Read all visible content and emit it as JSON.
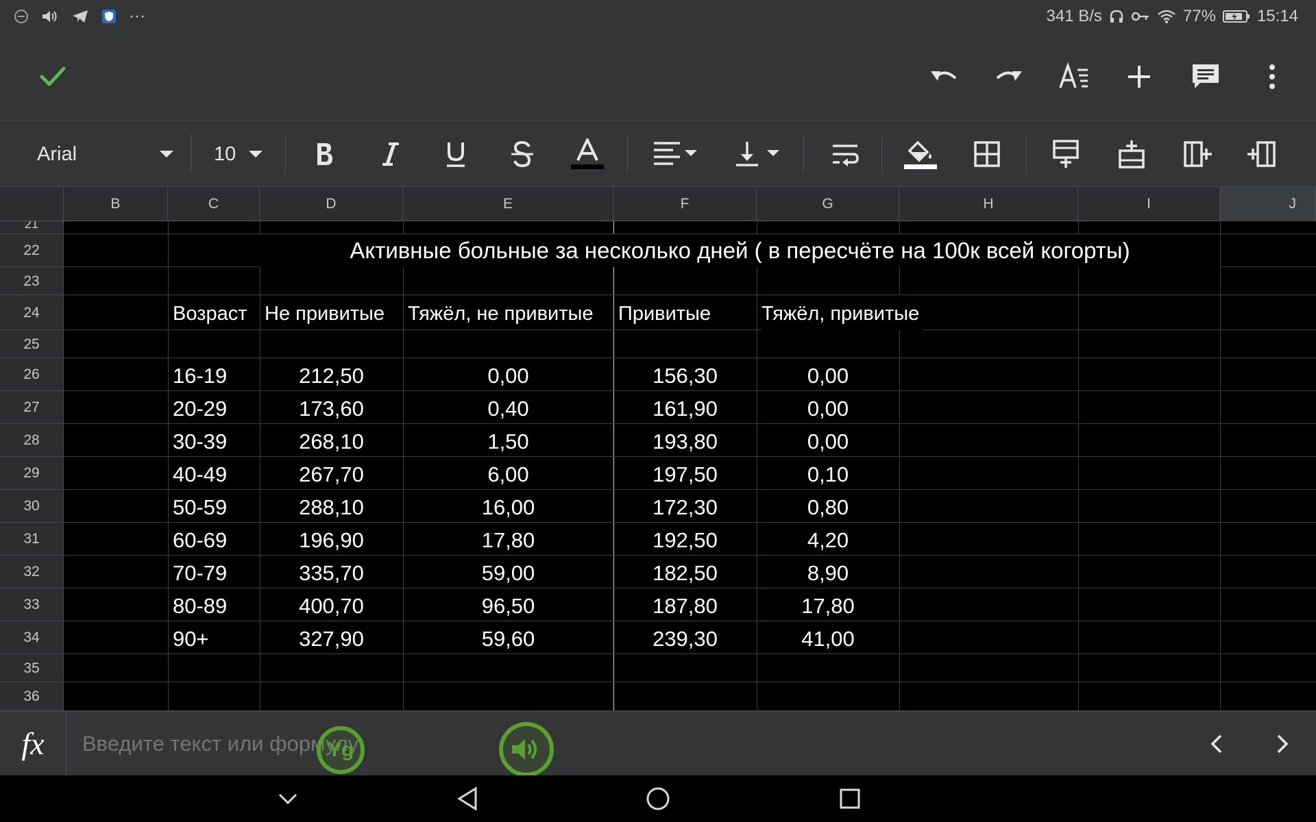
{
  "status_bar": {
    "network_speed": "341 B/s",
    "battery": "77%",
    "time": "15:14",
    "more": "···"
  },
  "toolbar": {
    "font_family": "Arial",
    "font_size": "10"
  },
  "columns": [
    "B",
    "C",
    "D",
    "E",
    "F",
    "G",
    "H",
    "I",
    "J"
  ],
  "rows": {
    "partial_top": "21",
    "numbers": [
      "22",
      "23",
      "24",
      "25",
      "26",
      "27",
      "28",
      "29",
      "30",
      "31",
      "32",
      "33",
      "34",
      "35",
      "36"
    ]
  },
  "sheet": {
    "title": "Активные больные за несколько дней  ( в пересчёте на 100к всей когорты)",
    "headers": {
      "age": "Возраст",
      "unvaccinated": "Не привитые",
      "severe_unvaccinated": "Тяжёл, не привитые",
      "vaccinated": "Привитые",
      "severe_vaccinated": "Тяжёл, привитые"
    },
    "data": [
      [
        "16-19",
        "212,50",
        "0,00",
        "156,30",
        "0,00"
      ],
      [
        "20-29",
        "173,60",
        "0,40",
        "161,90",
        "0,00"
      ],
      [
        "30-39",
        "268,10",
        "1,50",
        "193,80",
        "0,00"
      ],
      [
        "40-49",
        "267,70",
        "6,00",
        "197,50",
        "0,10"
      ],
      [
        "50-59",
        "288,10",
        "16,00",
        "172,30",
        "0,80"
      ],
      [
        "60-69",
        "196,90",
        "17,80",
        "192,50",
        "4,20"
      ],
      [
        "70-79",
        "335,70",
        "59,00",
        "182,50",
        "8,90"
      ],
      [
        "80-89",
        "400,70",
        "96,50",
        "187,80",
        "17,80"
      ],
      [
        "90+",
        "327,90",
        "59,60",
        "239,30",
        "41,00"
      ]
    ]
  },
  "formula_bar": {
    "fx_label": "fx",
    "placeholder": "Введите текст или формулу"
  },
  "overlay": {
    "keyboard_bubble": "Yg"
  },
  "colors": {
    "chrome": "#333537",
    "check_green": "#5cb85c",
    "overlay_green": "#5aa02c"
  }
}
